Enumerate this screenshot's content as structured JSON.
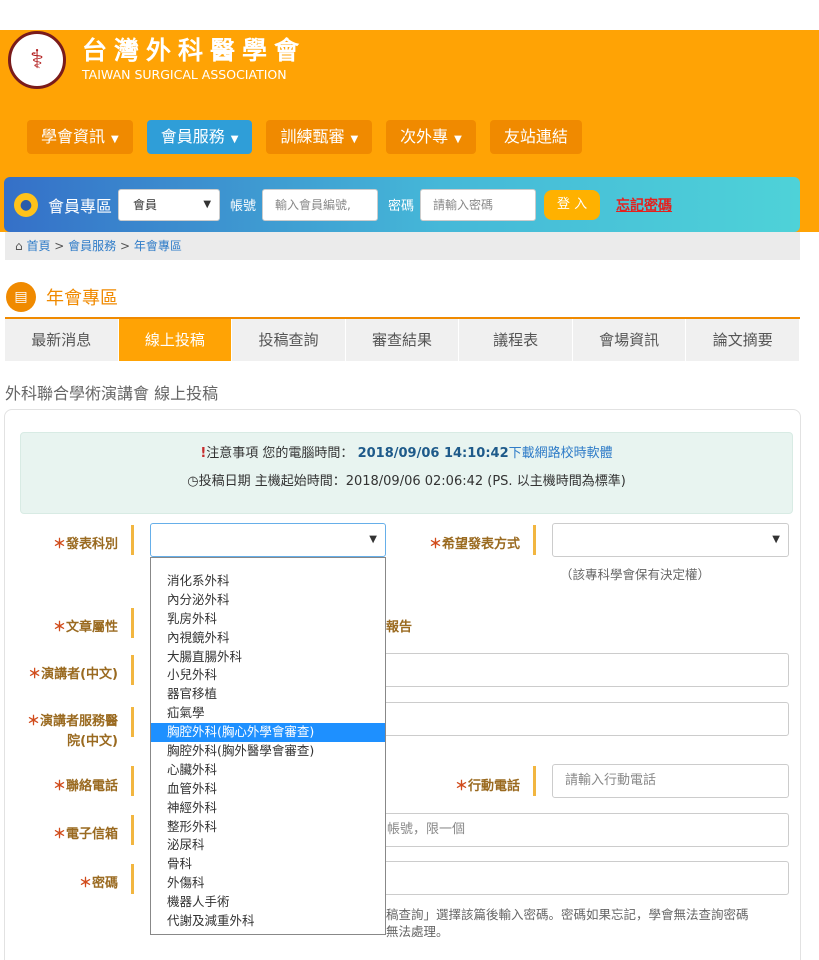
{
  "header": {
    "logo_title": "台灣外科醫學會",
    "logo_subtitle": "TAIWAN SURGICAL ASSOCIATION",
    "logo_icon": "caduceus-emblem",
    "brand_color": "#FFA305"
  },
  "nav": {
    "items": [
      {
        "label": "學會資訊",
        "has_caret": true
      },
      {
        "label": "會員服務",
        "has_caret": true
      },
      {
        "label": "訓練甄審",
        "has_caret": true
      },
      {
        "label": "次外專",
        "has_caret": true
      },
      {
        "label": "友站連結",
        "has_caret": false
      }
    ],
    "active": "會員服務"
  },
  "member_bar": {
    "title": "會員專區",
    "role_select": "會員",
    "account_label": "帳號",
    "account_placeholder": "輸入會員編號,",
    "password_label": "密碼",
    "password_placeholder": "請輸入密碼",
    "login_label": "登 入",
    "forgot_label": "忘記密碼"
  },
  "breadcrumb": {
    "home": "首頁",
    "sep": " > ",
    "level1": "會員服務",
    "level2": "年會專區"
  },
  "section": {
    "title": "年會專區"
  },
  "tabs": [
    {
      "label": "最新消息"
    },
    {
      "label": "線上投稿"
    },
    {
      "label": "投稿查詢"
    },
    {
      "label": "審查結果"
    },
    {
      "label": "議程表"
    },
    {
      "label": "會場資訊"
    },
    {
      "label": "論文摘要"
    }
  ],
  "active_tab": "線上投稿",
  "page_subtitle": "外科聯合學術演講會 線上投稿",
  "notice": {
    "line1_prefix": "注意事項 您的電腦時間：",
    "line1_time": "2018/09/06 14:10:42",
    "line1_link": "下載網路校時軟體",
    "line2": "投稿日期 主機起始時間：2018/09/06 02:06:42 (PS. 以主機時間為標準)"
  },
  "form": {
    "category_label": "發表科別",
    "category_value": "",
    "method_label": "希望發表方式",
    "method_help": "（該專科學會保有決定權）",
    "article_label": "文章屬性",
    "article_partial": "報告",
    "speaker_cn_label": "演講者(中文)",
    "hospital_label_1": "演講者服務醫",
    "hospital_label_2": "院(中文)",
    "phone_label": "聯絡電話",
    "mobile_label": "行動電話",
    "mobile_placeholder": "請輸入行動電話",
    "email_label": "電子信箱",
    "email_hint": "帳號，限一個",
    "password_label": "密碼",
    "password_help_1": "稿查詢」選擇該篇後輸入密碼。密碼如果忘記，學會無法查詢密碼",
    "password_help_2": "無法處理。"
  },
  "dropdown": {
    "options": [
      "消化系外科",
      "內分泌外科",
      "乳房外科",
      "內視鏡外科",
      "大腸直腸外科",
      "小兒外科",
      "器官移植",
      "疝氣學",
      "胸腔外科(胸心外學會審查)",
      "胸腔外科(胸外醫學會審查)",
      "心臟外科",
      "血管外科",
      "神經外科",
      "整形外科",
      "泌尿科",
      "骨科",
      "外傷科",
      "機器人手術",
      "代謝及減重外科"
    ],
    "selected": "胸腔外科(胸心外學會審查)"
  }
}
